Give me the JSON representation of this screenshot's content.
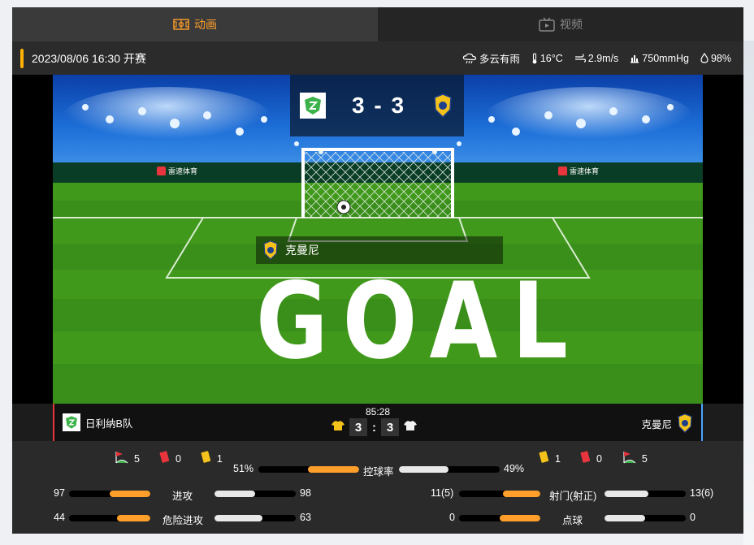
{
  "tabs": [
    {
      "label": "动画",
      "active": true
    },
    {
      "label": "视频",
      "active": false
    }
  ],
  "info": {
    "kickoff": "2023/08/06 16:30 开赛",
    "weather": "多云有雨",
    "temperature": "16°C",
    "wind": "2.9m/s",
    "pressure": "750mmHg",
    "humidity": "98%"
  },
  "field": {
    "score": "3 - 3",
    "sponsor": "雷速体育",
    "event_team": "克曼尼",
    "goal_text": "GOAL"
  },
  "strip": {
    "home_name": "日利纳B队",
    "away_name": "克曼尼",
    "clock": "85:28",
    "home_score": "3",
    "away_score": "3",
    "colon": ":"
  },
  "stats": {
    "home_corners": "5",
    "home_red": "0",
    "home_yellow": "1",
    "away_yellow": "1",
    "away_red": "0",
    "away_corners": "5",
    "possession": {
      "label": "控球率",
      "home": "51%",
      "away": "49%",
      "home_frac": 0.51,
      "away_frac": 0.49
    },
    "attack": {
      "label": "进攻",
      "home": "97",
      "away": "98",
      "home_frac": 0.5,
      "away_frac": 0.5
    },
    "dangerous": {
      "label": "危险进攻",
      "home": "44",
      "away": "63",
      "home_frac": 0.41,
      "away_frac": 0.59
    },
    "shots": {
      "label": "射门(射正)",
      "home": "11(5)",
      "away": "13(6)",
      "home_frac": 0.46,
      "away_frac": 0.54
    },
    "penalties": {
      "label": "点球",
      "home": "0",
      "away": "0",
      "home_frac": 0.5,
      "away_frac": 0.5
    }
  },
  "colors": {
    "accent": "#ff9f2b",
    "home_line": "#e8343c",
    "away_line": "#4aa3ff"
  }
}
